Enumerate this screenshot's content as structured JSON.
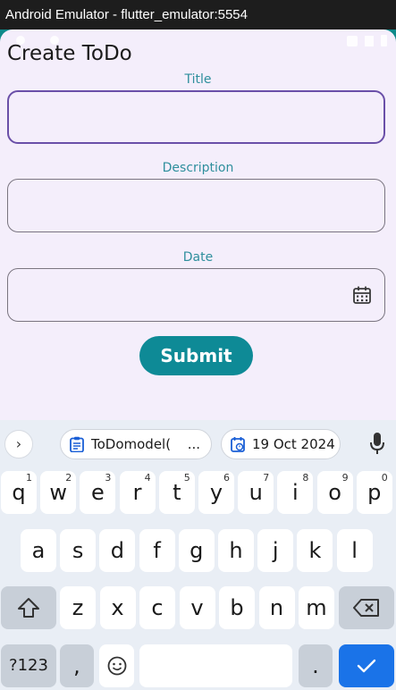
{
  "window": {
    "title": "Android Emulator - flutter_emulator:5554"
  },
  "app": {
    "title": "Create ToDo",
    "fields": {
      "title_label": "Title",
      "description_label": "Description",
      "date_label": "Date"
    },
    "submit_label": "Submit"
  },
  "keyboard": {
    "suggestions": {
      "chip1": "ToDomodel(",
      "chip1_more": "...",
      "chip2": "19 Oct 2024"
    },
    "row1": [
      {
        "k": "q",
        "h": "1"
      },
      {
        "k": "w",
        "h": "2"
      },
      {
        "k": "e",
        "h": "3"
      },
      {
        "k": "r",
        "h": "4"
      },
      {
        "k": "t",
        "h": "5"
      },
      {
        "k": "y",
        "h": "6"
      },
      {
        "k": "u",
        "h": "7"
      },
      {
        "k": "i",
        "h": "8"
      },
      {
        "k": "o",
        "h": "9"
      },
      {
        "k": "p",
        "h": "0"
      }
    ],
    "row2": [
      "a",
      "s",
      "d",
      "f",
      "g",
      "h",
      "j",
      "k",
      "l"
    ],
    "row3": [
      "z",
      "x",
      "c",
      "v",
      "b",
      "n",
      "m"
    ],
    "symbols_label": "?123",
    "comma": ",",
    "period": "."
  },
  "colors": {
    "accent": "#0e8a96",
    "focus_border": "#6a4fa8",
    "label": "#2f8f9d",
    "enter": "#1a73e8"
  }
}
